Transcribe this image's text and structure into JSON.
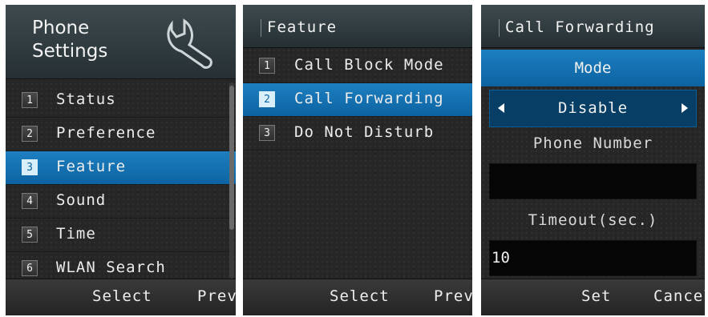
{
  "panel1": {
    "title": "Phone\nSettings",
    "icon": "wrench-icon",
    "items": [
      {
        "num": "1",
        "label": "Status"
      },
      {
        "num": "2",
        "label": "Preference"
      },
      {
        "num": "3",
        "label": "Feature"
      },
      {
        "num": "4",
        "label": "Sound"
      },
      {
        "num": "5",
        "label": "Time"
      },
      {
        "num": "6",
        "label": "WLAN Search"
      }
    ],
    "selected_index": 2,
    "softkey_left": "Select",
    "softkey_right": "Prev"
  },
  "panel2": {
    "title": "Feature",
    "items": [
      {
        "num": "1",
        "label": "Call Block Mode"
      },
      {
        "num": "2",
        "label": "Call Forwarding"
      },
      {
        "num": "3",
        "label": "Do Not Disturb"
      }
    ],
    "selected_index": 1,
    "softkey_left": "Select",
    "softkey_right": "Prev"
  },
  "panel3": {
    "title": "Call Forwarding",
    "mode_label": "Mode",
    "mode_value": "Disable",
    "phone_number_label": "Phone Number",
    "phone_number_value": "",
    "timeout_label": "Timeout(sec.)",
    "timeout_value": "10",
    "softkey_left": "Set",
    "softkey_right": "Cancel"
  },
  "colors": {
    "selection_blue": "#0d63a1",
    "background": "#262626",
    "header": "#2f3b3f"
  }
}
